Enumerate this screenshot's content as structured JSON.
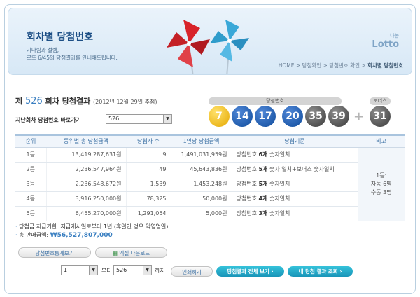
{
  "header": {
    "title": "회차별 당첨번호",
    "desc_line1": "기다림과 설렘,",
    "desc_line2": "로또 6/45의 당첨결과를 안내해드립니다.",
    "logo_top": "나눔",
    "logo": "Lotto",
    "breadcrumb": [
      "HOME",
      "당첨확인",
      "당첨번호 확인",
      "회차별 당첨번호"
    ]
  },
  "round": {
    "prefix": "제",
    "number": "526",
    "suffix": "회차 당첨결과",
    "date": "(2012년 12월 29일 추첨)"
  },
  "past": {
    "label": "지난회차 당첨번호 바로가기",
    "selected": "526"
  },
  "balls_label": "당첨번호",
  "bonus_label": "보너스",
  "balls": [
    "7",
    "14",
    "17",
    "20",
    "35",
    "39"
  ],
  "bonus": "31",
  "ball_colors": {
    "yellow": "#e5a800",
    "blue": "#0f4c9c",
    "gray": "#3a3a3a"
  },
  "table": {
    "headers": [
      "순위",
      "등위별 총 당첨금액",
      "당첨자 수",
      "1인당 당첨금액",
      "당첨기준",
      "비고"
    ],
    "rows": [
      {
        "rank": "1등",
        "total": "13,419,287,631원",
        "winners": "9",
        "per": "1,491,031,959원",
        "crit_a": "당첨번호 ",
        "crit_b": "6개",
        "crit_c": " 숫자일치"
      },
      {
        "rank": "2등",
        "total": "2,236,547,964원",
        "winners": "49",
        "per": "45,643,836원",
        "crit_a": "당첨번호 ",
        "crit_b": "5개",
        "crit_c": " 숫자 일치+보너스 숫자일치"
      },
      {
        "rank": "3등",
        "total": "2,236,548,672원",
        "winners": "1,539",
        "per": "1,453,248원",
        "crit_a": "당첨번호 ",
        "crit_b": "5개",
        "crit_c": " 숫자일치"
      },
      {
        "rank": "4등",
        "total": "3,916,250,000원",
        "winners": "78,325",
        "per": "50,000원",
        "crit_a": "당첨번호 ",
        "crit_b": "4개",
        "crit_c": " 숫자일치"
      },
      {
        "rank": "5등",
        "total": "6,455,270,000원",
        "winners": "1,291,054",
        "per": "5,000원",
        "crit_a": "당첨번호 ",
        "crit_b": "3개",
        "crit_c": " 숫자일치"
      }
    ],
    "note_line1": "1등:",
    "note_line2": "자동 6명",
    "note_line3": "수동 3명"
  },
  "info": {
    "period_label": "당첨금 지급기한:",
    "period_value": "지급개시일로부터 1년 (휴일인 경우 익영업일)",
    "sales_label": "총 판매금액:",
    "sales_value": "₩56,527,807,000"
  },
  "buttons": {
    "stats": "당첨번호통계보기",
    "excel": "엑셀 다운로드",
    "print": "인쇄하기",
    "view_all": "당첨결과 전체 보기",
    "my_result": "내 당첨 결과 조회"
  },
  "range": {
    "from_value": "1",
    "from_label": "부터",
    "to_value": "526",
    "to_label": "까지"
  }
}
